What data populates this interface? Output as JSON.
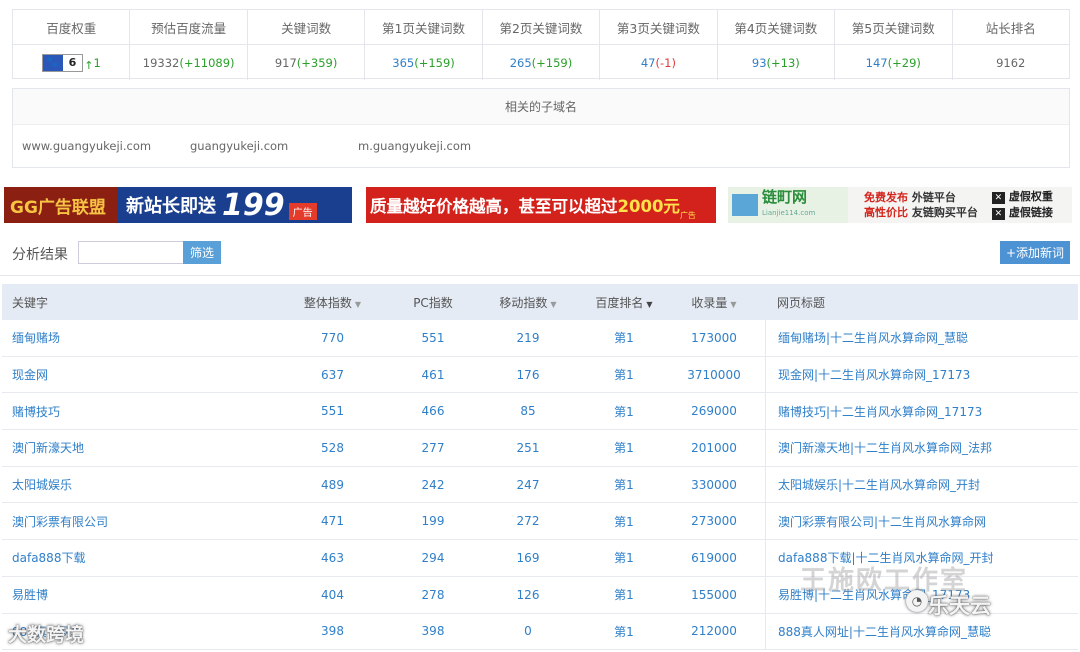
{
  "stats": {
    "headers": [
      "百度权重",
      "预估百度流量",
      "关键词数",
      "第1页关键词数",
      "第2页关键词数",
      "第3页关键词数",
      "第4页关键词数",
      "第5页关键词数",
      "站长排名"
    ],
    "weight": {
      "value": "6",
      "change": "1"
    },
    "traffic": {
      "value": "19332",
      "change": "(+11089)"
    },
    "keywords": {
      "value": "917",
      "change": "(+359)"
    },
    "page1": {
      "value": "365",
      "change": "(+159)"
    },
    "page2": {
      "value": "265",
      "change": "(+159)"
    },
    "page3": {
      "value": "47",
      "change": "(-1)"
    },
    "page4": {
      "value": "93",
      "change": "(+13)"
    },
    "page5": {
      "value": "147",
      "change": "(+29)"
    },
    "rank": "9162"
  },
  "subdomains": {
    "title": "相关的子域名",
    "items": [
      "www.guangyukeji.com",
      "guangyukeji.com",
      "m.guangyukeji.com"
    ]
  },
  "ads": {
    "ad1": {
      "brand": "GG广告联盟",
      "text": "新站长即送",
      "number": "199",
      "tag": "广告"
    },
    "ad2": {
      "text": "质量越好价格越高，甚至可以超过",
      "amount": "2000元",
      "tag": "广告"
    },
    "ad3": {
      "logo": "链町网",
      "logo_sub": "Lianjie114.com",
      "line1_a": "免费发布",
      "line1_b": "外链平台",
      "line2_a": "高性价比",
      "line2_b": "友链购买平台",
      "right1": "虚假权重",
      "right2": "虚假链接"
    }
  },
  "analysis": {
    "label": "分析结果",
    "filter_value": "",
    "filter_button": "筛选",
    "add_button": "+添加新词"
  },
  "table": {
    "headers": {
      "keyword": "关键字",
      "overall": "整体指数",
      "pc": "PC指数",
      "mobile": "移动指数",
      "rank": "百度排名",
      "indexed": "收录量",
      "title": "网页标题"
    },
    "rows": [
      {
        "keyword": "缅甸赌场",
        "overall": "770",
        "pc": "551",
        "mobile": "219",
        "rank": "第1",
        "indexed": "173000",
        "title": "缅甸赌场|十二生肖风水算命网_慧聪"
      },
      {
        "keyword": "现金网",
        "overall": "637",
        "pc": "461",
        "mobile": "176",
        "rank": "第1",
        "indexed": "3710000",
        "title": "现金网|十二生肖风水算命网_17173"
      },
      {
        "keyword": " 赌博技巧",
        "overall": "551",
        "pc": "466",
        "mobile": "85",
        "rank": "第1",
        "indexed": "269000",
        "title": " 赌博技巧|十二生肖风水算命网_17173"
      },
      {
        "keyword": "澳门新濠天地",
        "overall": "528",
        "pc": "277",
        "mobile": "251",
        "rank": "第1",
        "indexed": "201000",
        "title": "澳门新濠天地|十二生肖风水算命网_法邦"
      },
      {
        "keyword": "太阳城娱乐",
        "overall": "489",
        "pc": "242",
        "mobile": "247",
        "rank": "第1",
        "indexed": "330000",
        "title": "太阳城娱乐|十二生肖风水算命网_开封"
      },
      {
        "keyword": "澳门彩票有限公司",
        "overall": "471",
        "pc": "199",
        "mobile": "272",
        "rank": "第1",
        "indexed": "273000",
        "title": "澳门彩票有限公司|十二生肖风水算命网"
      },
      {
        "keyword": "dafa888下载",
        "overall": "463",
        "pc": "294",
        "mobile": "169",
        "rank": "第1",
        "indexed": "619000",
        "title": "dafa888下载|十二生肖风水算命网_开封"
      },
      {
        "keyword": "易胜博",
        "overall": "404",
        "pc": "278",
        "mobile": "126",
        "rank": "第1",
        "indexed": "155000",
        "title": "易胜博|十二生肖风水算命网_17173"
      },
      {
        "keyword": "888真人网址",
        "overall": "398",
        "pc": "398",
        "mobile": "0",
        "rank": "第1",
        "indexed": "212000",
        "title": "888真人网址|十二生肖风水算命网_慧聪"
      }
    ]
  },
  "watermarks": {
    "studio": "王施欧工作室",
    "brand": "乐天云",
    "corner": "大数跨境"
  },
  "colors": {
    "link": "#2f7fc9",
    "up": "#2aa02a",
    "down": "#e03b3b",
    "header_bg": "#e4ebf4",
    "button": "#5aa0d8"
  }
}
